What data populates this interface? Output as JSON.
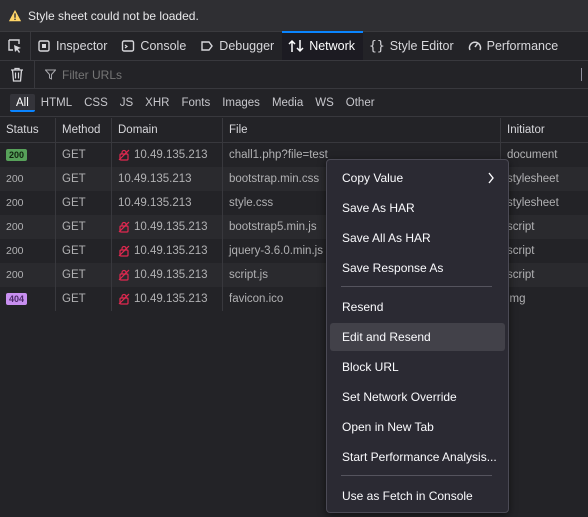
{
  "warning": {
    "text": "Style sheet could not be loaded."
  },
  "toolbar": {
    "tabs": [
      {
        "label": "Inspector",
        "icon": "inspector-icon"
      },
      {
        "label": "Console",
        "icon": "console-icon"
      },
      {
        "label": "Debugger",
        "icon": "debugger-icon"
      },
      {
        "label": "Network",
        "icon": "network-icon",
        "active": true
      },
      {
        "label": "Style Editor",
        "icon": "style-editor-icon"
      },
      {
        "label": "Performance",
        "icon": "performance-icon"
      }
    ]
  },
  "filter": {
    "placeholder": "Filter URLs"
  },
  "types": [
    "All",
    "HTML",
    "CSS",
    "JS",
    "XHR",
    "Fonts",
    "Images",
    "Media",
    "WS",
    "Other"
  ],
  "columns": [
    "Status",
    "Method",
    "Domain",
    "File",
    "Initiator"
  ],
  "rows": [
    {
      "status": "200",
      "method": "GET",
      "domain": "10.49.135.213",
      "insecure": true,
      "file": "chall1.php?file=test",
      "initiator": "document"
    },
    {
      "status": "200",
      "method": "GET",
      "domain": "10.49.135.213",
      "insecure": false,
      "file": "bootstrap.min.css",
      "initiator": "stylesheet"
    },
    {
      "status": "200",
      "method": "GET",
      "domain": "10.49.135.213",
      "insecure": false,
      "file": "style.css",
      "initiator": "stylesheet"
    },
    {
      "status": "200",
      "method": "GET",
      "domain": "10.49.135.213",
      "insecure": true,
      "file": "bootstrap5.min.js",
      "initiator": "script"
    },
    {
      "status": "200",
      "method": "GET",
      "domain": "10.49.135.213",
      "insecure": true,
      "file": "jquery-3.6.0.min.js",
      "initiator": "script"
    },
    {
      "status": "200",
      "method": "GET",
      "domain": "10.49.135.213",
      "insecure": true,
      "file": "script.js",
      "initiator": "script"
    },
    {
      "status": "404",
      "method": "GET",
      "domain": "10.49.135.213",
      "insecure": true,
      "file": "favicon.ico",
      "initiator": "img"
    }
  ],
  "context_menu": {
    "items": [
      {
        "label": "Copy Value",
        "submenu": true
      },
      {
        "label": "Save As HAR"
      },
      {
        "label": "Save All As HAR"
      },
      {
        "label": "Save Response As"
      },
      {
        "label": "Resend"
      },
      {
        "label": "Edit and Resend",
        "hovered": true
      },
      {
        "label": "Block URL"
      },
      {
        "label": "Set Network Override"
      },
      {
        "label": "Open in New Tab"
      },
      {
        "label": "Start Performance Analysis..."
      },
      {
        "label": "Use as Fetch in Console"
      }
    ]
  },
  "colors": {
    "accent": "#0a84ff",
    "status_ok": "#57a15a",
    "status_not_found": "#c88ff0",
    "warning": "#ffd567"
  }
}
